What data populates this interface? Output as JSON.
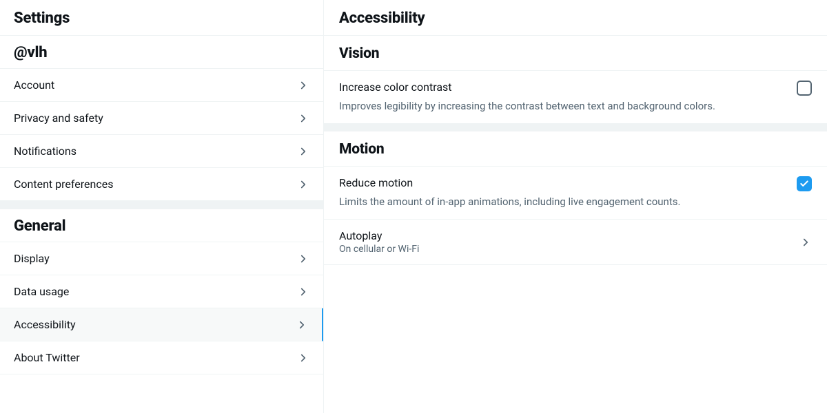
{
  "sidebar": {
    "title": "Settings",
    "handle": "@vlh",
    "top_items": [
      {
        "label": "Account"
      },
      {
        "label": "Privacy and safety"
      },
      {
        "label": "Notifications"
      },
      {
        "label": "Content preferences"
      }
    ],
    "general_heading": "General",
    "general_items": [
      {
        "label": "Display",
        "active": false
      },
      {
        "label": "Data usage",
        "active": false
      },
      {
        "label": "Accessibility",
        "active": true
      },
      {
        "label": "About Twitter",
        "active": false
      }
    ]
  },
  "main": {
    "title": "Accessibility",
    "groups": {
      "vision": {
        "heading": "Vision",
        "contrast": {
          "label": "Increase color contrast",
          "description": "Improves legibility by increasing the contrast between text and background colors.",
          "checked": false
        }
      },
      "motion": {
        "heading": "Motion",
        "reduce_motion": {
          "label": "Reduce motion",
          "description": "Limits the amount of in-app animations, including live engagement counts.",
          "checked": true
        },
        "autoplay": {
          "label": "Autoplay",
          "value": "On cellular or Wi-Fi"
        }
      }
    }
  },
  "colors": {
    "accent": "#1d9bf0",
    "text_secondary": "#536471",
    "border": "#eff3f4"
  }
}
